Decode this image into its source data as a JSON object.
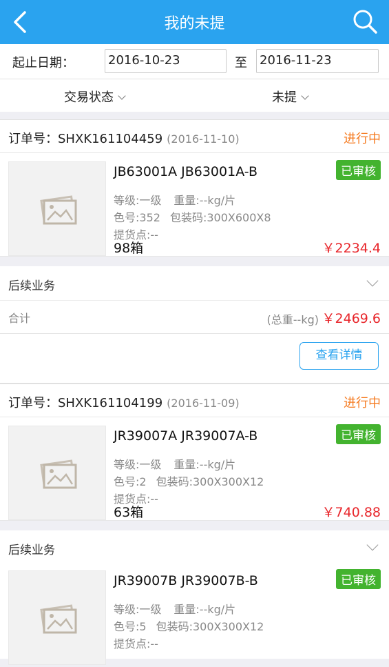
{
  "header": {
    "title": "我的未提",
    "back_icon": "chevron-left-icon",
    "search_icon": "search-icon"
  },
  "date_filter": {
    "label": "起止日期：",
    "start": "2016-10-23",
    "separator": "至",
    "end": "2016-11-23"
  },
  "filters": {
    "trade_status": "交易状态",
    "pickup_status": "未提"
  },
  "colors": {
    "brand": "#2aa3ef",
    "status": "#f57a1f",
    "price": "#e8262b",
    "badge": "#43b32f"
  },
  "orders": [
    {
      "order_no": "订单号：SHXK161104459",
      "date": "(2016-11-10)",
      "status": "进行中",
      "items": [
        {
          "name": "JB63001A JB63001A-B",
          "badge": "已审核",
          "grade": "等级:一级",
          "weight": "重量:--kg/片",
          "color_no": "色号:352",
          "pack_code": "包装码:300X600X8",
          "pickup": "提货点:--",
          "qty": "98箱",
          "price": "￥2234.4"
        }
      ],
      "follow_label": "后续业务",
      "total_label": "合计",
      "total_weight": "(总重--kg)",
      "total_price": "￥2469.6",
      "detail_button": "查看详情"
    },
    {
      "order_no": "订单号：SHXK161104199",
      "date": "(2016-11-09)",
      "status": "进行中",
      "items": [
        {
          "name": "JR39007A JR39007A-B",
          "badge": "已审核",
          "grade": "等级:一级",
          "weight": "重量:--kg/片",
          "color_no": "色号:2",
          "pack_code": "包装码:300X300X12",
          "pickup": "提货点:--",
          "qty": "63箱",
          "price": "￥740.88"
        },
        {
          "name": "JR39007B JR39007B-B",
          "badge": "已审核",
          "grade": "等级:一级",
          "weight": "重量:--kg/片",
          "color_no": "色号:5",
          "pack_code": "包装码:300X300X12",
          "pickup": "提货点:--"
        }
      ],
      "follow_label": "后续业务"
    }
  ]
}
